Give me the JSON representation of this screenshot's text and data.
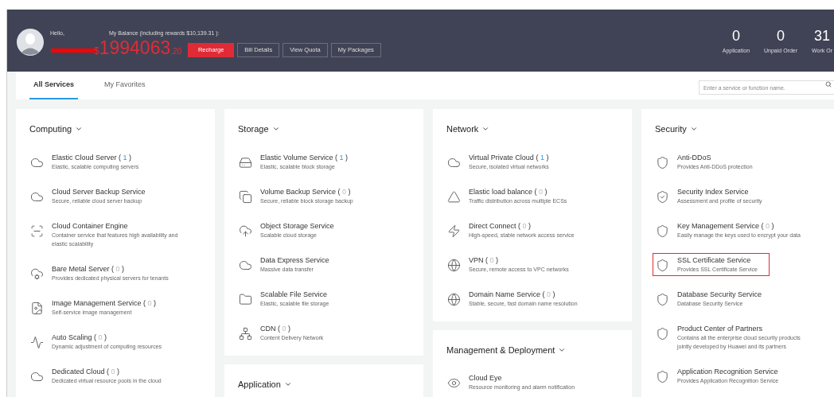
{
  "header": {
    "greeting": "Hello,",
    "balance_label": "My Balance (including rewards $10,139.31 ):",
    "balance": {
      "currency": "$",
      "amount": "1994063",
      "decimals": ".20"
    },
    "buttons": [
      {
        "label": "Recharge",
        "kind": "primary"
      },
      {
        "label": "Bill Details",
        "kind": "outline"
      },
      {
        "label": "View Quota",
        "kind": "outline"
      },
      {
        "label": "My Packages",
        "kind": "outline"
      }
    ],
    "stats": [
      {
        "value": "0",
        "label": "Application"
      },
      {
        "value": "0",
        "label": "Unpaid Order"
      },
      {
        "value": "31",
        "label": "Work Or"
      }
    ]
  },
  "tabs": [
    {
      "label": "All Services",
      "selected": true
    },
    {
      "label": "My Favorites",
      "selected": false
    }
  ],
  "search": {
    "placeholder": "Enter a service or function name."
  },
  "columns": [
    [
      {
        "title": "Computing",
        "items": [
          {
            "name": "Elastic Cloud Server",
            "count": {
              "before": "( ",
              "value": "1",
              "after": " )",
              "active": true
            },
            "desc": "Elastic, scalable computing servers",
            "outlined": false
          },
          {
            "name": "Cloud Server Backup Service",
            "desc": "Secure, reliable cloud server backup",
            "outlined": false
          },
          {
            "name": "Cloud Container Engine",
            "desc": "Container service that features high availability and elastic scalability",
            "outlined": false
          },
          {
            "name": "Bare Metal Server",
            "count": {
              "before": "( ",
              "value": "0",
              "after": " )",
              "active": false
            },
            "desc": "Provides dedicated physical servers for tenants",
            "outlined": false
          },
          {
            "name": "Image Management Service",
            "count": {
              "before": "( ",
              "value": "0",
              "after": " )",
              "active": false
            },
            "desc": "Self-service image management",
            "outlined": false
          },
          {
            "name": "Auto Scaling",
            "count": {
              "before": "( ",
              "value": "0",
              "after": " )",
              "active": false
            },
            "desc": "Dynamic adjustment of computing resources",
            "outlined": false
          },
          {
            "name": "Dedicated Cloud",
            "count": {
              "before": "( ",
              "value": "0",
              "after": " )",
              "active": false
            },
            "desc": "Dedicated virtual resource pools in the cloud",
            "outlined": false
          }
        ]
      }
    ],
    [
      {
        "title": "Storage",
        "items": [
          {
            "name": "Elastic Volume Service",
            "count": {
              "before": "( ",
              "value": "1",
              "after": " )",
              "active": true
            },
            "desc": "Elastic, scalable block storage",
            "outlined": false
          },
          {
            "name": "Volume Backup Service",
            "count": {
              "before": "( ",
              "value": "0",
              "after": " )",
              "active": false
            },
            "desc": "Secure, reliable block storage backup",
            "outlined": false
          },
          {
            "name": "Object Storage Service",
            "desc": "Scalable cloud storage",
            "outlined": false
          },
          {
            "name": "Data Express Service",
            "desc": "Massive data transfer",
            "outlined": false
          },
          {
            "name": "Scalable File Service",
            "desc": "Elastic, scalable file storage",
            "outlined": false
          },
          {
            "name": "CDN",
            "count": {
              "before": "( ",
              "value": "0",
              "after": " )",
              "active": false
            },
            "desc": "Content Delivery Network",
            "outlined": false
          }
        ]
      },
      {
        "title": "Application"
      }
    ],
    [
      {
        "title": "Network",
        "items": [
          {
            "name": "Virtual Private Cloud",
            "count": {
              "before": "( ",
              "value": "1",
              "after": " )",
              "active": true
            },
            "desc": "Secure, isolated virtual networks",
            "outlined": false
          },
          {
            "name": "Elastic load balance",
            "count": {
              "before": "( ",
              "value": "0",
              "after": " )",
              "active": false
            },
            "desc": "Traffic distribution across multiple ECSs",
            "outlined": false
          },
          {
            "name": "Direct Connect",
            "count": {
              "before": "( ",
              "value": "0",
              "after": " )",
              "active": false
            },
            "desc": "High-speed, stable network access service",
            "outlined": false
          },
          {
            "name": "VPN",
            "count": {
              "before": "( ",
              "value": "0",
              "after": " )",
              "active": false
            },
            "desc": "Secure, remote access to VPC networks",
            "outlined": false
          },
          {
            "name": "Domain Name Service",
            "count": {
              "before": "( ",
              "value": "0",
              "after": " )",
              "active": false
            },
            "desc": "Stable, secure, fast domain name resolution",
            "outlined": false
          }
        ]
      },
      {
        "title": "Management & Deployment",
        "items": [
          {
            "name": "Cloud Eye",
            "desc": "Resource monitoring and alarm notification",
            "outlined": false
          }
        ]
      }
    ],
    [
      {
        "title": "Security",
        "items": [
          {
            "name": "Anti-DDoS",
            "desc": "Provides Anti-DDoS protection",
            "outlined": false
          },
          {
            "name": "Security Index Service",
            "desc": "Assessment and profile of security",
            "outlined": false
          },
          {
            "name": "Key Management Service",
            "count": {
              "before": "( ",
              "value": "0",
              "after": " )",
              "active": false
            },
            "desc": "Easily manage the keys used to encrypt your data",
            "outlined": false
          },
          {
            "name": "SSL Certificate Service",
            "desc": "Provides SSL Certificate Service",
            "outlined": true
          },
          {
            "name": "Database Security Service",
            "desc": "Database Security Service",
            "outlined": false
          },
          {
            "name": "Product Center of Partners",
            "desc": "Contains all the enterprise cloud security products jointly developed by Huawei and its partners",
            "outlined": false
          },
          {
            "name": "Application Recognition Service",
            "desc": "Provides Application Recognition Service",
            "outlined": false
          }
        ]
      }
    ]
  ]
}
